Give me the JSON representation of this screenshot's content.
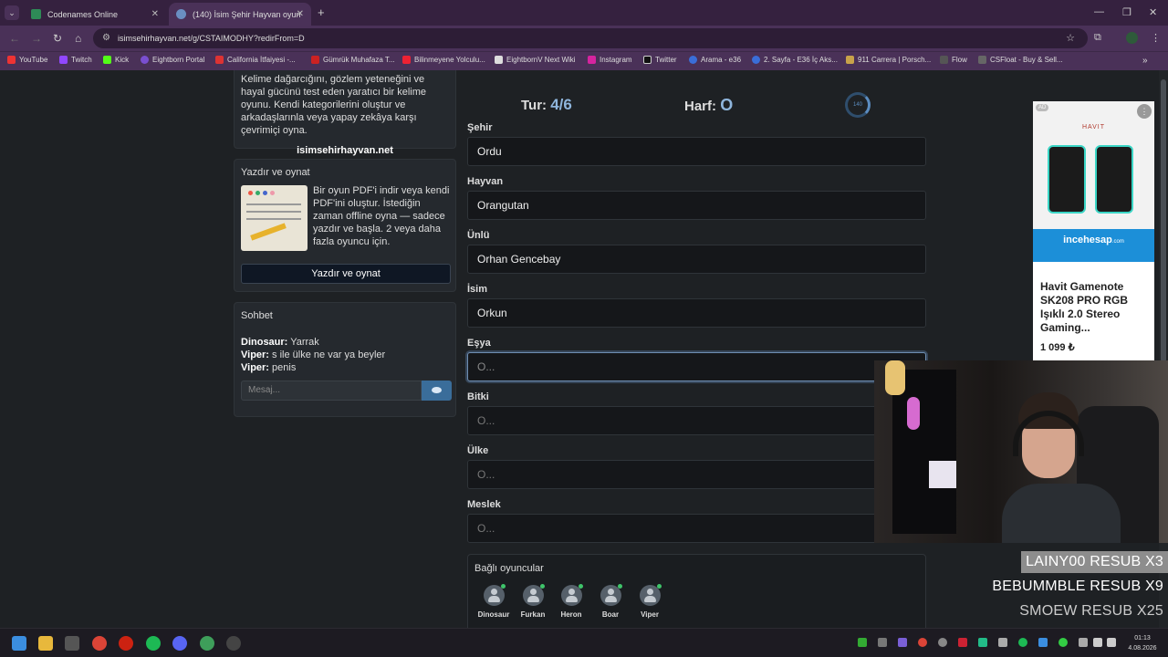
{
  "browser": {
    "tabs": [
      {
        "title": "Codenames Online",
        "active": false
      },
      {
        "title": "(140) İsim Şehir Hayvan oyunu",
        "active": true
      }
    ],
    "url": "isimsehirhayvan.net/g/CSTAIMODHY?redirFrom=D",
    "bookmarks": [
      "YouTube",
      "Twitch",
      "Kick",
      "Eightborn Portal",
      "California İtfaiyesi -...",
      "Gümrük Muhafaza T...",
      "Bilinmeyene Yolculu...",
      "EightbornV Next Wiki",
      "Instagram",
      "Twitter",
      "Arama - e36",
      "2. Sayfa - E36 İç Aks...",
      "911 Carrera | Porsch...",
      "Flow",
      "CSFloat - Buy & Sell..."
    ],
    "colors": {
      "frame": "#35213f",
      "toolbar": "#4a3158"
    }
  },
  "sidebar": {
    "intro": {
      "text": "Kelime dağarcığını, gözlem yeteneğini ve hayal gücünü test eden yaratıcı bir kelime oyunu. Kendi kategorilerini oluştur ve arkadaşlarınla veya yapay zekâya karşı çevrimiçi oyna.",
      "site": "isimsehirhayvan.net"
    },
    "print": {
      "title": "Yazdır ve oynat",
      "text": "Bir oyun PDF'i indir veya kendi PDF'ini oluştur. İstediğin zaman offline oyna — sadece yazdır ve başla. 2 veya daha fazla oyuncu için.",
      "button": "Yazdır ve oynat"
    },
    "chat": {
      "title": "Sohbet",
      "messages": [
        {
          "user": "Dinosaur:",
          "text": "Yarrak"
        },
        {
          "user": "Viper:",
          "text": "s ile ülke ne var ya beyler"
        },
        {
          "user": "Viper:",
          "text": "penis"
        }
      ],
      "placeholder": "Mesaj..."
    }
  },
  "game": {
    "round_label": "Tur:",
    "round_value": "4/6",
    "letter_label": "Harf:",
    "letter_value": "O",
    "timer": "140",
    "timer_fraction": 0.78,
    "fields": [
      {
        "label": "Şehir",
        "value": "Ordu",
        "placeholder": ""
      },
      {
        "label": "Hayvan",
        "value": "Orangutan",
        "placeholder": ""
      },
      {
        "label": "Ünlü",
        "value": "Orhan Gencebay",
        "placeholder": ""
      },
      {
        "label": "İsim",
        "value": "Orkun",
        "placeholder": ""
      },
      {
        "label": "Eşya",
        "value": "",
        "placeholder": "O..."
      },
      {
        "label": "Bitki",
        "value": "",
        "placeholder": "O..."
      },
      {
        "label": "Ülke",
        "value": "",
        "placeholder": "O..."
      },
      {
        "label": "Meslek",
        "value": "",
        "placeholder": "O..."
      }
    ],
    "players_title": "Bağlı oyuncular",
    "players": [
      "Dinosaur",
      "Furkan",
      "Heron",
      "Boar",
      "Viper"
    ]
  },
  "ad": {
    "brand": "HAVIT",
    "shop": "incehesap",
    "shop_tld": ".com",
    "title": "Havit Gamenote SK208 PRO RGB Işıklı 2.0 Stereo Gaming...",
    "price": "1 099 ₺",
    "badge": "AD"
  },
  "stream": {
    "subs": [
      {
        "text": "LAINY00   RESUB X3",
        "highlight": true
      },
      {
        "text": "BEBUMMBLE   RESUB X9",
        "highlight": false
      },
      {
        "text": "SMOEW   RESUB X25",
        "highlight": false
      }
    ]
  },
  "taskbar": {
    "time": "01:13",
    "date": "4.08.2026"
  }
}
